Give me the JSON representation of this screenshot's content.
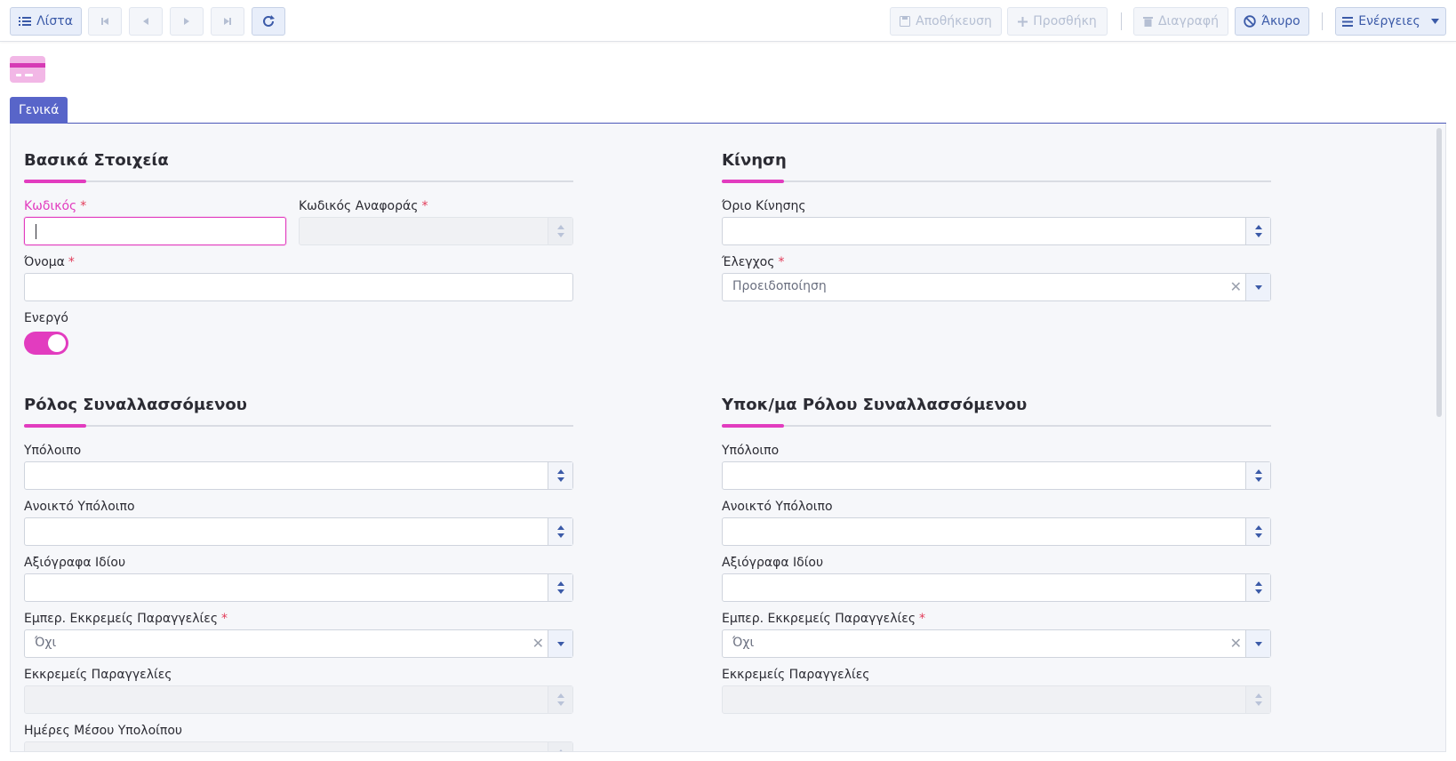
{
  "toolbar": {
    "list_label": "Λίστα",
    "save_label": "Αποθήκευση",
    "add_label": "Προσθήκη",
    "delete_label": "Διαγραφή",
    "cancel_label": "Άκυρο",
    "actions_label": "Ενέργειες"
  },
  "tabs": [
    {
      "label": "Γενικά",
      "active": true
    }
  ],
  "colors": {
    "accent": "#e23cbf",
    "primary": "#5865c9",
    "button_bg": "#e8eefa"
  },
  "basic": {
    "title": "Βασικά Στοιχεία",
    "code_label": "Κωδικός",
    "ref_code_label": "Κωδικός Αναφοράς",
    "name_label": "Όνομα",
    "active_label": "Ενεργό",
    "active_value": true
  },
  "movement": {
    "title": "Κίνηση",
    "limit_label": "Όριο Κίνησης",
    "check_label": "Έλεγχος",
    "check_value": "Προειδοποίηση"
  },
  "role": {
    "title": "Ρόλος Συναλλασσόμενου",
    "balance_label": "Υπόλοιπο",
    "open_balance_label": "Ανοικτό Υπόλοιπο",
    "own_notes_label": "Αξιόγραφα Ιδίου",
    "pending_comm_label": "Εμπερ. Εκκρεμείς Παραγγελίες",
    "pending_comm_value": "Όχι",
    "pending_orders_label": "Εκκρεμείς Παραγγελίες",
    "avg_days_label": "Ημέρες Μέσου Υπολοίπου"
  },
  "subrole": {
    "title": "Υποκ/μα Ρόλου Συναλλασσόμενου",
    "balance_label": "Υπόλοιπο",
    "open_balance_label": "Ανοικτό Υπόλοιπο",
    "own_notes_label": "Αξιόγραφα Ιδίου",
    "pending_comm_label": "Εμπερ. Εκκρεμείς Παραγγελίες",
    "pending_comm_value": "Όχι",
    "pending_orders_label": "Εκκρεμείς Παραγγελίες"
  },
  "icons": [
    "list-icon",
    "first-page-icon",
    "prev-page-icon",
    "next-page-icon",
    "last-page-icon",
    "refresh-icon",
    "save-icon",
    "plus-icon",
    "trash-icon",
    "ban-icon",
    "menu-icon",
    "caret-down-icon",
    "entity-card-icon"
  ]
}
